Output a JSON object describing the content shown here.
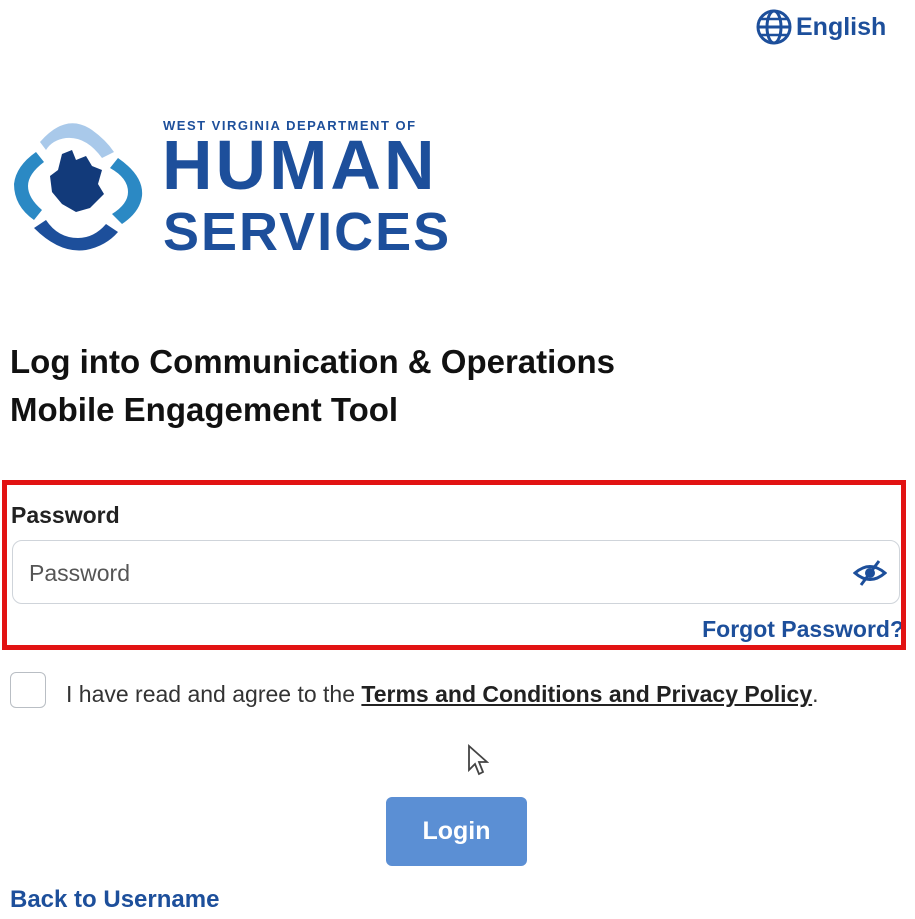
{
  "language": {
    "label": "English",
    "icon": "globe-icon"
  },
  "logo": {
    "top_line": "WEST VIRGINIA DEPARTMENT OF",
    "main_line": "HUMAN",
    "sub_line": "SERVICES",
    "icon": "west-virginia-logo-icon"
  },
  "title": {
    "line1": "Log into Communication & Operations",
    "line2": "Mobile Engagement Tool"
  },
  "password": {
    "label": "Password",
    "placeholder": "Password",
    "value": "",
    "toggle_icon": "eye-hidden-icon",
    "forgot_label": "Forgot Password?"
  },
  "terms": {
    "checked": false,
    "prefix": "I have read and agree to the ",
    "link_label": "Terms and Conditions and Privacy Policy",
    "suffix": "."
  },
  "login": {
    "label": "Login"
  },
  "back": {
    "label": "Back to Username"
  },
  "colors": {
    "brand_blue": "#1d4f9b",
    "button_blue": "#5b8fd4",
    "highlight_red": "#e21313",
    "logo_light_blue": "#a9c9ea",
    "logo_teal": "#2b89c4"
  }
}
